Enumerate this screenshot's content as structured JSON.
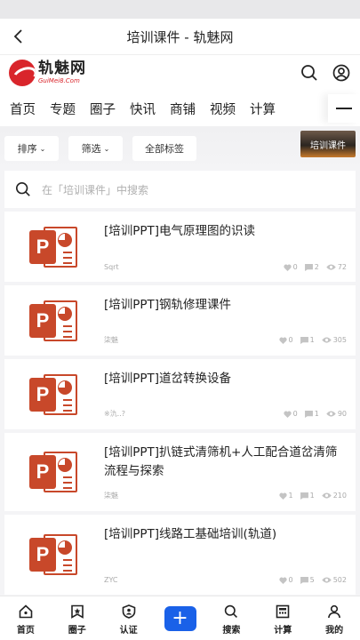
{
  "header": {
    "title": "培训课件 - 轨魅网"
  },
  "logo": {
    "cn": "轨魅网",
    "en": "GuiMei8.Com"
  },
  "nav": [
    "首页",
    "专题",
    "圈子",
    "快讯",
    "商铺",
    "视频",
    "计算"
  ],
  "filters": {
    "sort": "排序",
    "filter": "筛选",
    "all_tags": "全部标签",
    "banner": "培训课件"
  },
  "search": {
    "placeholder": "在「培训课件」中搜索"
  },
  "items": [
    {
      "title": "[培训PPT]电气原理图的识读",
      "author": "Sqrt",
      "likes": "0",
      "comments": "2",
      "views": "72"
    },
    {
      "title": "[培训PPT]钢轨修理课件",
      "author": "柒魅",
      "likes": "0",
      "comments": "1",
      "views": "305"
    },
    {
      "title": "[培训PPT]道岔转换设备",
      "author": "※氿..?",
      "likes": "0",
      "comments": "1",
      "views": "90"
    },
    {
      "title": "[培训PPT]扒链式清筛机+人工配合道岔清筛流程与探索",
      "author": "柒魅",
      "likes": "1",
      "comments": "1",
      "views": "210"
    },
    {
      "title": "[培训PPT]线路工基础培训(轨道)",
      "author": "ZYC",
      "likes": "0",
      "comments": "5",
      "views": "502"
    }
  ],
  "tabs": [
    {
      "label": "首页",
      "icon": "home-icon"
    },
    {
      "label": "圈子",
      "icon": "bookmark-star-icon"
    },
    {
      "label": "认证",
      "icon": "shield-user-icon"
    },
    {
      "label": "",
      "icon": "plus-icon"
    },
    {
      "label": "搜索",
      "icon": "search-icon"
    },
    {
      "label": "计算",
      "icon": "calculator-icon"
    },
    {
      "label": "我的",
      "icon": "user-icon"
    }
  ],
  "colors": {
    "accent": "#1a61e8",
    "brand": "#d9252b",
    "ppt": "#c8482a"
  }
}
